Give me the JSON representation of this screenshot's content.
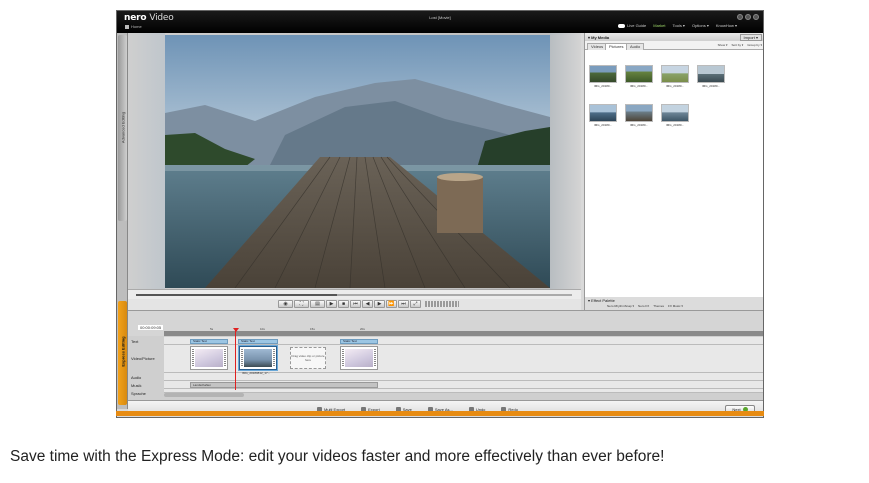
{
  "app": {
    "brand": "nero",
    "product": "Video",
    "home_label": "Home",
    "window_title": "Lost [Movie]"
  },
  "topmenu": {
    "live_guide": "Live Guide",
    "market": "Market",
    "tools": "Tools ▾",
    "options": "Options ▾",
    "knowhow": "KnowHow ▾"
  },
  "side_tabs": {
    "advanced": "Advanced Editing",
    "express": "Express Editing"
  },
  "media_panel": {
    "title": "▾ My Media",
    "import": "Import ▾",
    "tabs": [
      "Videos",
      "Pictures",
      "Audio"
    ],
    "sort": [
      "Show ▾",
      "Sort by ▾",
      "Group by ▾"
    ],
    "thumbs": [
      {
        "caption": "IMG_20180...",
        "tone": "forest"
      },
      {
        "caption": "IMG_20180...",
        "tone": "green"
      },
      {
        "caption": "IMG_20180...",
        "tone": "field"
      },
      {
        "caption": "IMG_20180...",
        "tone": "person"
      },
      {
        "caption": "IMG_20180...",
        "tone": "lake"
      },
      {
        "caption": "IMG_20180...",
        "tone": "pier"
      },
      {
        "caption": "IMG_20180...",
        "tone": "shore"
      }
    ]
  },
  "effect_palette": {
    "title": "▾ Effect Palette",
    "items": [
      "Nero RhythmSnap ▾",
      "Nero FX",
      "Themes",
      "FX Music ▾"
    ]
  },
  "timeline": {
    "time": "00:00:09:05",
    "ticks": [
      "5s",
      "10s",
      "15s",
      "20s"
    ],
    "rows": [
      "Text",
      "Video/Picture",
      "Audio",
      "Musik",
      "Sprache"
    ],
    "text_clips": [
      "Static Text",
      "Static Text",
      "Static Text"
    ],
    "clip_caption": "IMG_20180812_17...",
    "drop_hint": "Drag video clip or picture here",
    "music_clip": "Landschaften"
  },
  "bottom": {
    "actions": [
      "Multi Export",
      "Export",
      "Save",
      "Save As...",
      "Undo",
      "Redo"
    ],
    "next": "Next"
  },
  "caption": "Save time with the Express Mode: edit your videos faster and more effectively than ever before!"
}
